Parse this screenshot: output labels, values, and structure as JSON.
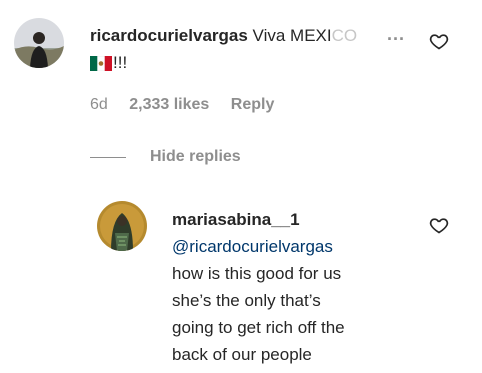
{
  "comment": {
    "username": "ricardocurielvargas",
    "text_visible": "Viva MEXI",
    "text_faded": "CO",
    "ellipsis": "...",
    "flag_emoji": "🇲🇽",
    "exclaim": "!!!",
    "time": "6d",
    "likes": "2,333 likes",
    "reply_label": "Reply",
    "heart_icon": "heart-outline-icon"
  },
  "replies_toggle": {
    "label": "Hide replies"
  },
  "reply": {
    "username": "mariasabina__1",
    "mention": "@ricardocurielvargas",
    "lines": [
      "how is this good for us",
      "she’s the only that’s",
      "going to get rich off the",
      "back of our people"
    ],
    "heart_icon": "heart-outline-icon"
  },
  "colors": {
    "text": "#262626",
    "muted": "#8e8e8e",
    "mention": "#00376b",
    "flag_green": "#006847",
    "flag_red": "#ce1126"
  }
}
